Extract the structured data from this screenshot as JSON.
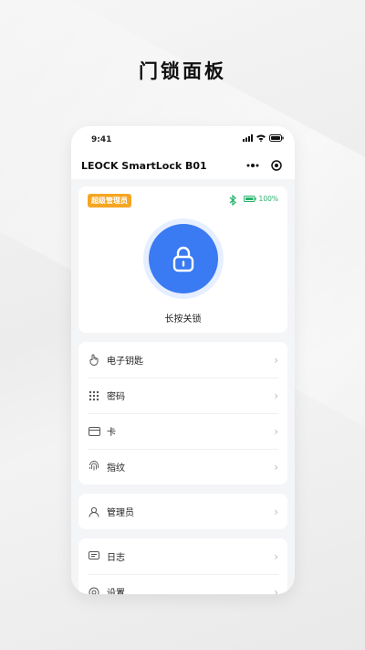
{
  "headline": "门锁面板",
  "status_bar": {
    "time": "9:41"
  },
  "nav": {
    "title": "LEOCK SmartLock B01"
  },
  "lock_panel": {
    "role_badge": "超级管理员",
    "battery": "100%",
    "action_label": "长按关锁"
  },
  "menu_groups": [
    [
      {
        "label": "电子钥匙",
        "icon": "hand-icon"
      },
      {
        "label": "密码",
        "icon": "keypad-icon"
      },
      {
        "label": "卡",
        "icon": "card-icon"
      },
      {
        "label": "指纹",
        "icon": "fingerprint-icon"
      }
    ],
    [
      {
        "label": "管理员",
        "icon": "user-icon"
      }
    ],
    [
      {
        "label": "日志",
        "icon": "log-icon"
      },
      {
        "label": "设置",
        "icon": "settings-icon"
      }
    ]
  ],
  "colors": {
    "accent": "#3a7af2",
    "badge": "#f4a623",
    "battery": "#27b36b"
  }
}
